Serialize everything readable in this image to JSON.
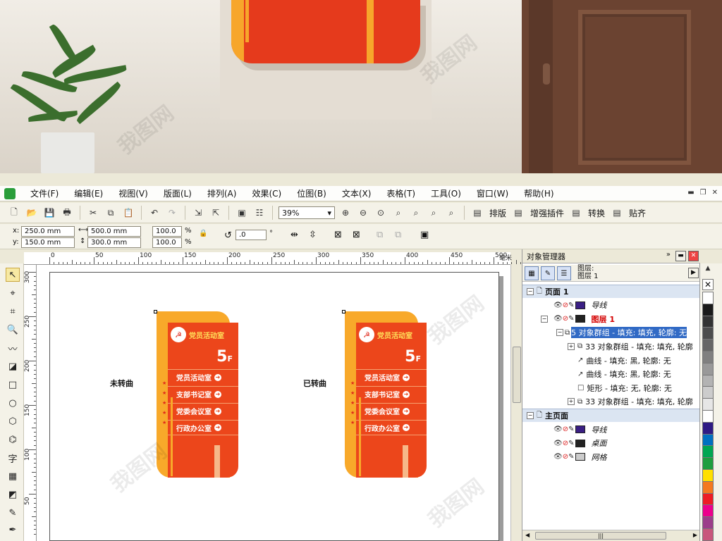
{
  "menu": [
    "文件(F)",
    "编辑(E)",
    "视图(V)",
    "版面(L)",
    "排列(A)",
    "效果(C)",
    "位图(B)",
    "文本(X)",
    "表格(T)",
    "工具(O)",
    "窗口(W)",
    "帮助(H)"
  ],
  "toolbar": {
    "zoom": "39%",
    "layout_label": "排版",
    "plugin_label": "增强插件",
    "convert_label": "转换",
    "snap_label": "贴齐"
  },
  "props": {
    "x_label": "x:",
    "x_value": "250.0 mm",
    "y_label": "y:",
    "y_value": "150.0 mm",
    "w_value": "500.0 mm",
    "h_value": "300.0 mm",
    "scale_x": "100.0",
    "scale_y": "100.0",
    "percent": "%",
    "rotation": ".0",
    "degree": "°"
  },
  "ruler": {
    "h": [
      "0",
      "50",
      "100",
      "150",
      "200",
      "250",
      "300",
      "350",
      "400",
      "450",
      "500"
    ],
    "unit": "毫米",
    "v": [
      "300",
      "250",
      "200",
      "150",
      "100",
      "50"
    ]
  },
  "canvas": {
    "left_caption": "未转曲",
    "right_caption": "已转曲",
    "sign": {
      "title": "党员活动室",
      "floor": "5",
      "floor_suffix": "F",
      "items": [
        "党员活动室",
        "支部书记室",
        "党委会议室",
        "行政办公室"
      ]
    }
  },
  "docker": {
    "title": "对象管理器",
    "layer_label_top": "图层:",
    "layer_label_bottom": "图层 1",
    "rows": [
      {
        "text": "页面 1",
        "kind": "section"
      },
      {
        "text": "导线",
        "kind": "layer",
        "color": "#3a1f84",
        "italic": true
      },
      {
        "text": "图层 1",
        "kind": "layer",
        "color": "#222222",
        "active": true
      },
      {
        "text": "5 对象群组 - 填充: 填充, 轮廓: 无",
        "kind": "obj",
        "selected": true
      },
      {
        "text": "33 对象群组 - 填充: 填充, 轮廓",
        "kind": "obj2"
      },
      {
        "text": "曲线 - 填充: 黑, 轮廓: 无",
        "kind": "curve"
      },
      {
        "text": "曲线 - 填充: 黑, 轮廓: 无",
        "kind": "curve"
      },
      {
        "text": "矩形 - 填充: 无, 轮廓: 无",
        "kind": "rect"
      },
      {
        "text": "33 对象群组 - 填充: 填充, 轮廓",
        "kind": "obj2"
      },
      {
        "text": "主页面",
        "kind": "section"
      },
      {
        "text": "导线",
        "kind": "master",
        "color": "#3a1f84"
      },
      {
        "text": "桌面",
        "kind": "master",
        "color": "#222222"
      },
      {
        "text": "网格",
        "kind": "master",
        "color": "#cccccc"
      }
    ]
  },
  "palette": [
    "#ffffff",
    "#1a1a1a",
    "#333333",
    "#4d4d4d",
    "#666666",
    "#808080",
    "#999999",
    "#b3b3b3",
    "#cccccc",
    "#e6e6e6",
    "#ffffff",
    "#2e1a84",
    "#0070c0",
    "#00a651",
    "#1e9e3e",
    "#ffe000",
    "#f47920",
    "#ee1c25",
    "#ec008c",
    "#9c3d8a",
    "#c8567c",
    "#f4a6a0"
  ]
}
